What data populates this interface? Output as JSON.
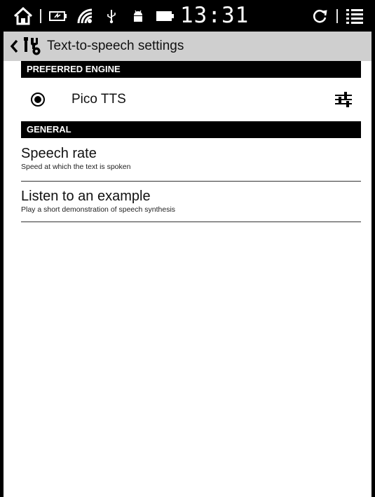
{
  "status_bar": {
    "time": "13:31",
    "icons": [
      "home-icon",
      "battery-icon",
      "wifi-icon",
      "usb-icon",
      "android-icon",
      "sync-icon",
      "menu-icon"
    ]
  },
  "action_bar": {
    "title": "Text-to-speech settings",
    "icons": [
      "back-icon",
      "settings-app-icon"
    ]
  },
  "sections": {
    "preferred_engine": {
      "header": "PREFERRED ENGINE",
      "engine": {
        "label": "Pico TTS",
        "selected": true
      }
    },
    "general": {
      "header": "GENERAL",
      "items": [
        {
          "title": "Speech rate",
          "summary": "Speed at which the text is spoken"
        },
        {
          "title": "Listen to an example",
          "summary": "Play a short demonstration of speech synthesis"
        }
      ]
    }
  }
}
